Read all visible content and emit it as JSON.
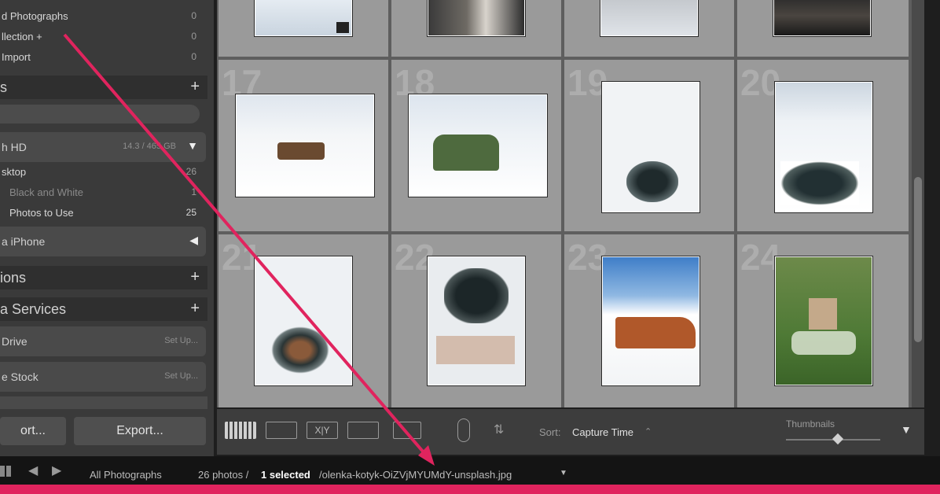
{
  "collections": {
    "items": [
      {
        "label": "d Photographs",
        "count": "0"
      },
      {
        "label": "llection  +",
        "count": "0"
      },
      {
        "label": "Import",
        "count": "0"
      }
    ]
  },
  "folders": {
    "header": "s",
    "search_placeholder": "",
    "drives": [
      {
        "label": "h HD",
        "meta": "14.3 / 465 GB"
      },
      {
        "label": "a iPhone",
        "meta": ""
      }
    ],
    "items": [
      {
        "label": "sktop",
        "count": "26"
      },
      {
        "label": "Black and White",
        "count": "1"
      },
      {
        "label": "Photos to Use",
        "count": "25"
      }
    ]
  },
  "sections": {
    "collections_label": "ions",
    "publish_label": "a Services"
  },
  "publish": {
    "items": [
      {
        "label": "Drive",
        "action": "Set Up..."
      },
      {
        "label": "e Stock",
        "action": "Set Up..."
      }
    ]
  },
  "buttons": {
    "import": "ort...",
    "export": "Export..."
  },
  "grid": {
    "cells": [
      {
        "num": "",
        "photo": "snow-hole"
      },
      {
        "num": "",
        "photo": "house"
      },
      {
        "num": "",
        "photo": "ice"
      },
      {
        "num": "",
        "photo": "box"
      },
      {
        "num": "17",
        "photo": "sled-small"
      },
      {
        "num": "18",
        "photo": "green-trailer"
      },
      {
        "num": "19",
        "photo": "ice-hole-tool"
      },
      {
        "num": "20",
        "photo": "ice-hole-auger"
      },
      {
        "num": "21",
        "photo": "ice-hole-vertical"
      },
      {
        "num": "22",
        "photo": "ice-hole-closeup"
      },
      {
        "num": "23",
        "photo": "wooden-sled"
      },
      {
        "num": "24",
        "photo": "grave-cross"
      }
    ]
  },
  "toolbar": {
    "sort_label": "Sort:",
    "sort_value": "Capture Time",
    "thumbnails_label": "Thumbnails",
    "thumbnail_size": 0.55
  },
  "filmstrip": {
    "source": "All Photographs",
    "count": "26 photos /",
    "selected": "1 selected",
    "filename": "/olenka-kotyk-OiZVjMYUMdY-unsplash.jpg"
  },
  "colors": {
    "panel": "#3a3a3a",
    "grid": "#9a9a9a",
    "accent": "#e0245e"
  }
}
